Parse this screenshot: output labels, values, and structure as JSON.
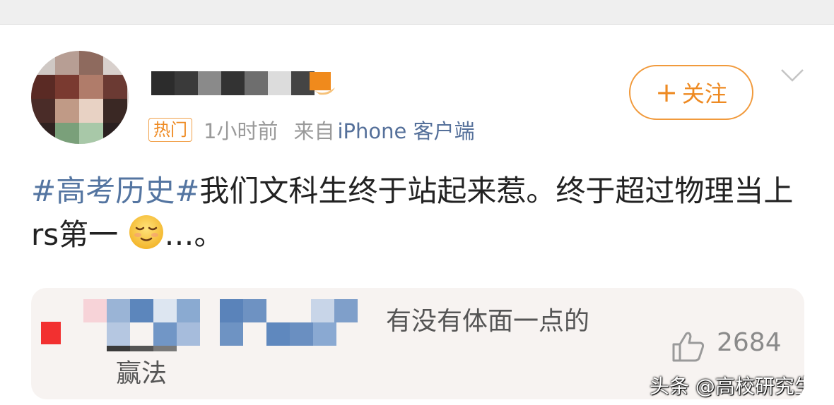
{
  "post": {
    "badge": "热门",
    "time": "1小时前",
    "source_prefix": "来自",
    "source_name": "iPhone 客户端",
    "follow_label": "关注",
    "content": {
      "hashtag": "#高考历史#",
      "text": "我们文科生终于站起来惹。终于超过物理当上rs第一",
      "emoji": "relieved-face-emoji",
      "suffix": "…。"
    }
  },
  "repost": {
    "text_line1": "有没有体面一点的",
    "text_line2": "赢法",
    "like_count": "2684"
  },
  "watermark": "头条 @高校研究生",
  "colors": {
    "accent_orange": "#ee8a22",
    "link_blue": "#5475a1",
    "text": "#222222"
  }
}
